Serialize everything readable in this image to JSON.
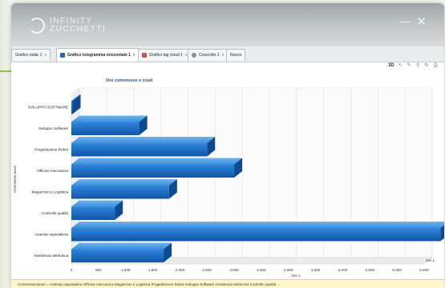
{
  "app": {
    "logo_line1": "INFINITY",
    "logo_line2": "ZUCCHETTI",
    "minimize_label": "—",
    "close_label": "✕"
  },
  "tabs": [
    {
      "label": "Grafico radar 1",
      "icon": "none"
    },
    {
      "label": "Grafico istogramma orizzontale 1",
      "icon": "bar-chart-icon",
      "active": true
    },
    {
      "label": "Grafico tag cloud 1",
      "icon": "tag-cloud-icon"
    },
    {
      "label": "Cruscotto 1",
      "icon": "gauge-icon"
    },
    {
      "label": "Nuovo",
      "icon": "none"
    }
  ],
  "toolbar": {
    "mode_label": "3D",
    "icons": [
      "cursor-icon",
      "edit-icon",
      "link-icon",
      "refresh-icon",
      "print-icon"
    ]
  },
  "status_text": "Commessa lavori = Azienda ospedaliera Officine meccanica Magazzino e Logistica Progettazione Robot Sviluppo Software Assistenza telefonica Controllo qualità ...",
  "chart_data": {
    "type": "bar",
    "orientation": "horizontal",
    "three_d": true,
    "title": "Ore commesse e costi",
    "xlabel": "Ore 1",
    "ylabel": "Commessa lavori",
    "legend_label": "Ore 1",
    "categories": [
      "SVILUPPO SOFTWARE",
      "Sviluppo Software",
      "Progettazione Robot",
      "Officine meccanica",
      "Magazzino e Logistica",
      "Controllo qualità",
      "Azienda ospedaliera",
      "Assistenza telefonica"
    ],
    "values": [
      10,
      1250,
      2500,
      3000,
      1800,
      800,
      6800,
      1700
    ],
    "xlim": [
      0,
      6500
    ],
    "xticks": [
      "0",
      "500",
      "1.000",
      "1.500",
      "2.000",
      "2.500",
      "3.000",
      "3.500",
      "4.000",
      "4.500",
      "5.000",
      "5.500",
      "6.000",
      "6.500"
    ],
    "grid": true,
    "bar_color": "#1f6fc4"
  }
}
